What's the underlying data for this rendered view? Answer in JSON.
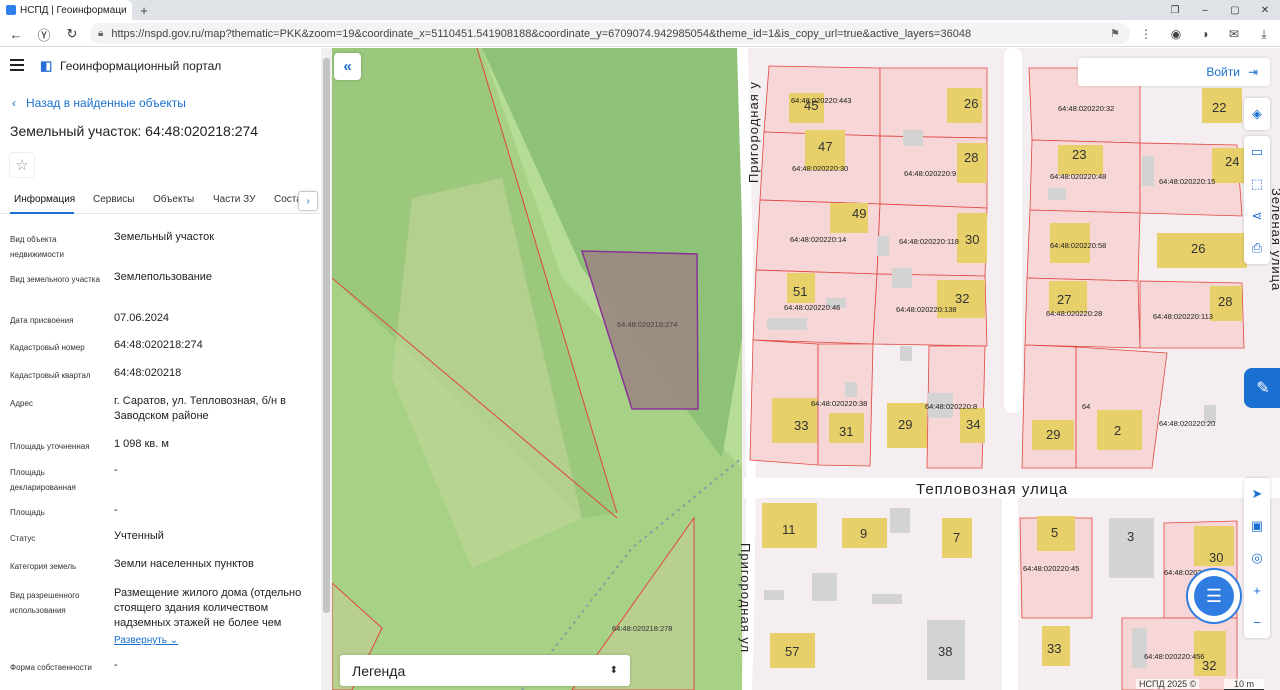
{
  "browser": {
    "tab_title": "НСПД | Геоинформаци",
    "url": "https://nspd.gov.ru/map?thematic=PKK&zoom=19&coordinate_x=5110451.541908188&coordinate_y=6709074.942985054&theme_id=1&is_copy_url=true&active_layers=36048"
  },
  "panel": {
    "portal_name": "Геоинформационный портал",
    "back_link": "Назад в найденные объекты",
    "title": "Земельный участок: 64:48:020218:274",
    "tabs": [
      "Информация",
      "Сервисы",
      "Объекты",
      "Части ЗУ",
      "Соста"
    ],
    "fields": [
      {
        "key": "Вид объекта недвижимости",
        "value": "Земельный участок"
      },
      {
        "key": "Вид земельного участка",
        "value": "Землепользование"
      },
      {
        "key": "Дата присвоения",
        "value": "07.06.2024"
      },
      {
        "key": "Кадастровый номер",
        "value": "64:48:020218:274"
      },
      {
        "key": "Кадастровый квартал",
        "value": "64:48:020218"
      },
      {
        "key": "Адрес",
        "value": "г. Саратов, ул. Тепловозная, б/н в Заводском районе"
      },
      {
        "key": "Площадь уточненная",
        "value": "1 098 кв. м"
      },
      {
        "key": "Площадь декларированная",
        "value": "-"
      },
      {
        "key": "Площадь",
        "value": "-"
      },
      {
        "key": "Статус",
        "value": "Учтенный"
      },
      {
        "key": "Категория земель",
        "value": "Земли населенных пунктов"
      },
      {
        "key": "Вид разрешенного использования",
        "value": "Размещение жилого дома (отдельно стоящего здания количеством надземных этажей не более чем"
      },
      {
        "key": "Форма собственности",
        "value": "-"
      }
    ],
    "expand_link": "Развернуть"
  },
  "map": {
    "login_label": "Войти",
    "legend_label": "Легенда",
    "street_main": "Тепловозная улица",
    "street_side_top": "Пригородная у",
    "street_side_bottom": "Пригородная ул",
    "street_right": "Зеленая улица",
    "copyright": "НСПД 2025 ©",
    "scale": "10 m",
    "selected_parcel": "64:48:020218:274",
    "parcel_278": "64:48:020218:278",
    "parcel_labels": [
      "64:48:020220:443",
      "64:48:020220:30",
      "64:48:020220:14",
      "64:48:020220:46",
      "64:48:020220:38",
      "64:48:020220:9",
      "64:48:020220:118",
      "64:48:020220:138",
      "64:48:020220:8",
      "64:48:020220:32",
      "64:48:020220:48",
      "64:48:020220:15",
      "64:48:020220:58",
      "64:48:020220:28",
      "64:48:020220:113",
      "64",
      "64:48:020220:20",
      "64:48:020220:45",
      "64:48:020220:449",
      "64:48:020220:456"
    ],
    "house_numbers": [
      "45",
      "47",
      "49",
      "51",
      "33",
      "31",
      "26",
      "28",
      "30",
      "32",
      "29",
      "34",
      "22",
      "23",
      "24",
      "26",
      "27",
      "28",
      "29",
      "2",
      "11",
      "9",
      "7",
      "5",
      "3",
      "30",
      "57",
      "38",
      "33",
      "32"
    ],
    "colors": {
      "forest": "#9bc87c",
      "parcel_fill": "#f6d9da",
      "parcel_border": "#e0453f",
      "building": "#e7cf6a",
      "selected": "#8c6fa0",
      "accent": "#1a6fd1"
    }
  }
}
